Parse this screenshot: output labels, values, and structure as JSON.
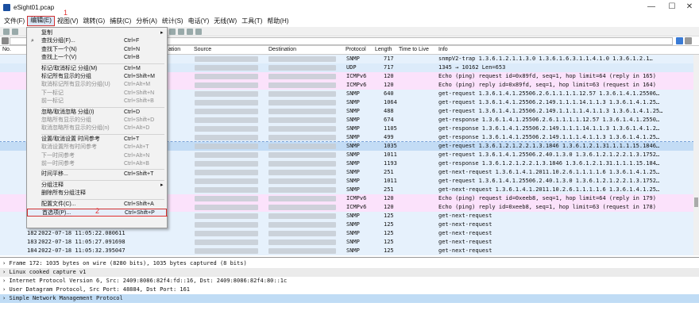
{
  "window": {
    "title": "eSight01.pcap",
    "minimize": "—",
    "maximize": "☐",
    "close": "✕"
  },
  "menubar": [
    "文件(F)",
    "编辑(E)",
    "视图(V)",
    "跳转(G)",
    "捕获(C)",
    "分析(A)",
    "统计(S)",
    "电话(Y)",
    "无线(W)",
    "工具(T)",
    "帮助(H)"
  ],
  "annotations": {
    "step1": "1",
    "step2": "2"
  },
  "columns": {
    "no": "No.",
    "time": "ation",
    "source": "Source",
    "destination": "Destination",
    "protocol": "Protocol",
    "length": "Length",
    "ttl": "Time to Live",
    "info": "Info"
  },
  "edit_menu": {
    "items": [
      {
        "label": "复制",
        "shortcut": "",
        "submenu": true,
        "disabled": false
      },
      {
        "label": "查找分组(F)...",
        "shortcut": "Ctrl+F",
        "disabled": false,
        "icon": "search-icon"
      },
      {
        "label": "查找下一个(N)",
        "shortcut": "Ctrl+N",
        "disabled": false
      },
      {
        "label": "查找上一个(V)",
        "shortcut": "Ctrl+B",
        "disabled": false
      },
      {
        "sep": true
      },
      {
        "label": "标记/取消标记 分组(M)",
        "shortcut": "Ctrl+M",
        "disabled": false
      },
      {
        "label": "标记所有显示的分组",
        "shortcut": "Ctrl+Shift+M",
        "disabled": false
      },
      {
        "label": "取消标记所有显示的分组(U)",
        "shortcut": "Ctrl+Alt+M",
        "disabled": true
      },
      {
        "label": "下一标记",
        "shortcut": "Ctrl+Shift+N",
        "disabled": true
      },
      {
        "label": "前一标记",
        "shortcut": "Ctrl+Shift+B",
        "disabled": true
      },
      {
        "sep": true
      },
      {
        "label": "忽略/取消忽略 分组(I)",
        "shortcut": "Ctrl+D",
        "disabled": false
      },
      {
        "label": "忽略所有显示的分组",
        "shortcut": "Ctrl+Shift+D",
        "disabled": true
      },
      {
        "label": "取消忽略所有显示的分组(n)",
        "shortcut": "Ctrl+Alt+D",
        "disabled": true
      },
      {
        "sep": true
      },
      {
        "label": "设置/取消设置 时间参考",
        "shortcut": "Ctrl+T",
        "disabled": false
      },
      {
        "label": "取消设置所有时间参考",
        "shortcut": "Ctrl+Alt+T",
        "disabled": true
      },
      {
        "label": "下一时间参考",
        "shortcut": "Ctrl+Alt+N",
        "disabled": true
      },
      {
        "label": "前一时间参考",
        "shortcut": "Ctrl+Alt+B",
        "disabled": true
      },
      {
        "sep": true
      },
      {
        "label": "时间平移...",
        "shortcut": "Ctrl+Shift+T",
        "disabled": false
      },
      {
        "sep": true
      },
      {
        "label": "分组注释",
        "shortcut": "",
        "submenu": true,
        "disabled": false
      },
      {
        "label": "删除所有分组注释",
        "shortcut": "",
        "disabled": false
      },
      {
        "sep": true
      },
      {
        "label": "配置文件(C)...",
        "shortcut": "Ctrl+Shift+A",
        "disabled": false
      },
      {
        "label": "首选项(P)...",
        "shortcut": "Ctrl+Shift+P",
        "disabled": false,
        "highlight": true
      }
    ]
  },
  "packets": [
    {
      "no": "",
      "time": "",
      "protocol": "SNMP",
      "length": "717",
      "info": "snmpV2-trap 1.3.6.1.2.1.1.3.0 1.3.6.1.6.3.1.1.4.1.0 1.3.6.1.2.1…",
      "bg": "#e6f1fc"
    },
    {
      "no": "",
      "time": "",
      "protocol": "UDP",
      "length": "717",
      "info": "1345 → 10162 Len=653",
      "bg": "#dcebfa"
    },
    {
      "no": "",
      "time": "",
      "protocol": "ICMPv6",
      "length": "120",
      "info": "Echo (ping) request id=0x89fd, seq=1, hop limit=64 (reply in 165)",
      "bg": "#fbe2fb"
    },
    {
      "no": "",
      "time": "",
      "protocol": "ICMPv6",
      "length": "120",
      "info": "Echo (ping) reply id=0x89fd, seq=1, hop limit=63 (request in 164)",
      "bg": "#fbe2fb"
    },
    {
      "no": "",
      "time": "",
      "protocol": "SNMP",
      "length": "640",
      "info": "get-request 1.3.6.1.4.1.25506.2.6.1.1.1.1.12.57 1.3.6.1.4.1.25506…",
      "bg": "#e6f1fc"
    },
    {
      "no": "",
      "time": "",
      "protocol": "SNMP",
      "length": "1064",
      "info": "get-request 1.3.6.1.4.1.25506.2.149.1.1.1.14.1.1.3 1.3.6.1.4.1.25…",
      "bg": "#e6f1fc"
    },
    {
      "no": "",
      "time": "",
      "protocol": "SNMP",
      "length": "488",
      "info": "get-request 1.3.6.1.4.1.25506.2.149.1.1.1.1.4.1.1.3 1.3.6.1.4.1.25…",
      "bg": "#e6f1fc"
    },
    {
      "no": "",
      "time": "",
      "protocol": "SNMP",
      "length": "674",
      "info": "get-response 1.3.6.1.4.1.25506.2.6.1.1.1.1.12.57 1.3.6.1.4.1.2550…",
      "bg": "#e6f1fc"
    },
    {
      "no": "",
      "time": "",
      "protocol": "SNMP",
      "length": "1105",
      "info": "get-response 1.3.6.1.4.1.25506.2.149.1.1.1.14.1.1.3 1.3.6.1.4.1.2…",
      "bg": "#e6f1fc"
    },
    {
      "no": "",
      "time": "",
      "protocol": "SNMP",
      "length": "499",
      "info": "get-response 1.3.6.1.4.1.25506.2.149.1.1.1.4.1.1.3 1.3.6.1.4.1.25…",
      "bg": "#e6f1fc"
    },
    {
      "no": "",
      "time": "",
      "protocol": "SNMP",
      "length": "1035",
      "info": "get-request 1.3.6.1.2.1.2.2.1.3.1846 1.3.6.1.2.1.31.1.1.1.15.1846…",
      "bg": "#c3dcf5",
      "selected": true
    },
    {
      "no": "",
      "time": "",
      "protocol": "SNMP",
      "length": "1011",
      "info": "get-request 1.3.6.1.4.1.25506.2.40.1.3.0 1.3.6.1.2.1.2.2.1.3.1752…",
      "bg": "#e6f1fc"
    },
    {
      "no": "",
      "time": "",
      "protocol": "SNMP",
      "length": "1193",
      "info": "get-response 1.3.6.1.2.1.2.2.1.3.1846 1.3.6.1.2.1.31.1.1.1.15.184…",
      "bg": "#e6f1fc"
    },
    {
      "no": "",
      "time": "",
      "protocol": "SNMP",
      "length": "251",
      "info": "get-next-request 1.3.6.1.4.1.2011.10.2.6.1.1.1.1.6 1.3.6.1.4.1.25…",
      "bg": "#e6f1fc"
    },
    {
      "no": "",
      "time": "",
      "protocol": "SNMP",
      "length": "1011",
      "info": "get-request 1.3.6.1.4.1.25506.2.40.1.3.0 1.3.6.1.2.1.2.2.1.3.1752…",
      "bg": "#e6f1fc"
    },
    {
      "no": "",
      "time": "",
      "protocol": "SNMP",
      "length": "251",
      "info": "get-next-request 1.3.6.1.4.1.2011.10.2.6.1.1.1.1.6 1.3.6.1.4.1.25…",
      "bg": "#e6f1fc"
    },
    {
      "no": "",
      "time": "",
      "protocol": "ICMPv6",
      "length": "120",
      "info": "Echo (ping) request id=0xeeb8, seq=1, hop limit=64 (reply in 179)",
      "bg": "#fbe2fb"
    },
    {
      "no": "",
      "time": "",
      "protocol": "ICMPv6",
      "length": "120",
      "info": "Echo (ping) reply id=0xeeb8, seq=1, hop limit=63 (request in 178)",
      "bg": "#fbe2fb"
    },
    {
      "no": "",
      "time": "",
      "protocol": "SNMP",
      "length": "125",
      "info": "get-next-request",
      "bg": "#e6f1fc"
    },
    {
      "no": "",
      "time": "",
      "protocol": "SNMP",
      "length": "125",
      "info": "get-next-request",
      "bg": "#e6f1fc"
    },
    {
      "no": "182",
      "time": "2022-07-18 11:05:22.080611",
      "protocol": "SNMP",
      "length": "125",
      "info": "get-next-request",
      "bg": "#e6f1fc"
    },
    {
      "no": "183",
      "time": "2022-07-18 11:05:27.091698",
      "protocol": "SNMP",
      "length": "125",
      "info": "get-next-request",
      "bg": "#e6f1fc"
    },
    {
      "no": "184",
      "time": "2022-07-18 11:05:32.395047",
      "protocol": "SNMP",
      "length": "125",
      "info": "get-next-request",
      "bg": "#e6f1fc"
    }
  ],
  "details": [
    {
      "text": "Frame 172: 1035 bytes on wire (8280 bits), 1035 bytes captured (8   bits)",
      "style": ""
    },
    {
      "text": "Linux cooked capture v1",
      "style": "shade"
    },
    {
      "text": "Internet Protocol Version 6, Src: 2409:8086:82f4:fd::16, Dst: 2409:8086:82f4:80::1c",
      "style": ""
    },
    {
      "text": "User Datagram Protocol, Src Port: 48884, Dst Port: 161",
      "style": ""
    },
    {
      "text": "Simple Network Management Protocol",
      "style": "sel"
    }
  ]
}
